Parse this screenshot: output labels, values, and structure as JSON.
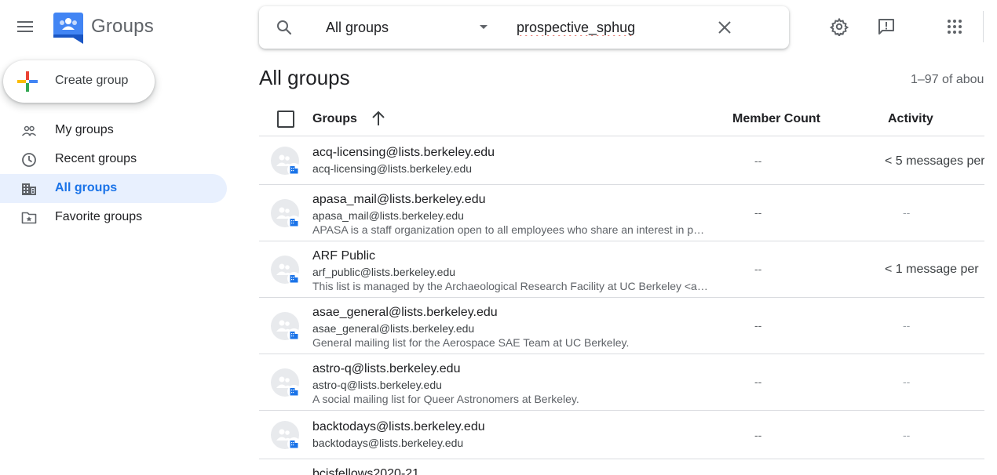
{
  "header": {
    "product_name": "Groups",
    "menu_icon": "hamburger-menu-icon",
    "logo_icon": "google-groups-logo"
  },
  "search": {
    "scope_label": "All groups",
    "query": "prospective_sphug",
    "icons": [
      "search-icon",
      "dropdown-caret-icon",
      "clear-icon"
    ]
  },
  "header_actions": [
    "settings-icon",
    "feedback-icon",
    "apps-grid-icon"
  ],
  "sidebar": {
    "create_label": "Create group",
    "items": [
      {
        "label": "My groups",
        "icon": "people-icon",
        "active": false
      },
      {
        "label": "Recent groups",
        "icon": "clock-icon",
        "active": false
      },
      {
        "label": "All groups",
        "icon": "building-icon",
        "active": true
      },
      {
        "label": "Favorite groups",
        "icon": "star-folder-icon",
        "active": false
      }
    ]
  },
  "main": {
    "title": "All groups",
    "result_count": "1–97 of abou",
    "columns": {
      "groups": "Groups",
      "member_count": "Member Count",
      "activity": "Activity"
    },
    "sort": "ascending",
    "rows": [
      {
        "name": "acq-licensing@lists.berkeley.edu",
        "email": "acq-licensing@lists.berkeley.edu",
        "description": "",
        "members": "--",
        "activity": "< 5 messages per"
      },
      {
        "name": "apasa_mail@lists.berkeley.edu",
        "email": "apasa_mail@lists.berkeley.edu",
        "description": "APASA is a staff organization open to all employees who share an interest in p…",
        "members": "--",
        "activity": "--"
      },
      {
        "name": "ARF Public",
        "email": "arf_public@lists.berkeley.edu",
        "description": "This list is managed by the Archaeological Research Facility at UC Berkeley <a…",
        "members": "--",
        "activity": "< 1 message per"
      },
      {
        "name": "asae_general@lists.berkeley.edu",
        "email": "asae_general@lists.berkeley.edu",
        "description": "General mailing list for the Aerospace SAE Team at UC Berkeley.",
        "members": "--",
        "activity": "--"
      },
      {
        "name": "astro-q@lists.berkeley.edu",
        "email": "astro-q@lists.berkeley.edu",
        "description": "A social mailing list for Queer Astronomers at Berkeley.",
        "members": "--",
        "activity": "--"
      },
      {
        "name": "backtodays@lists.berkeley.edu",
        "email": "backtodays@lists.berkeley.edu",
        "description": "",
        "members": "--",
        "activity": "--"
      },
      {
        "name": "bcisfellows2020-21",
        "email": "",
        "description": "",
        "members": "",
        "activity": ""
      }
    ]
  },
  "colors": {
    "accent": "#1a73e8",
    "active_nav_bg": "#e8f0fe",
    "divider": "#dadce0",
    "text_primary": "#202124",
    "text_secondary": "#5f6368"
  }
}
